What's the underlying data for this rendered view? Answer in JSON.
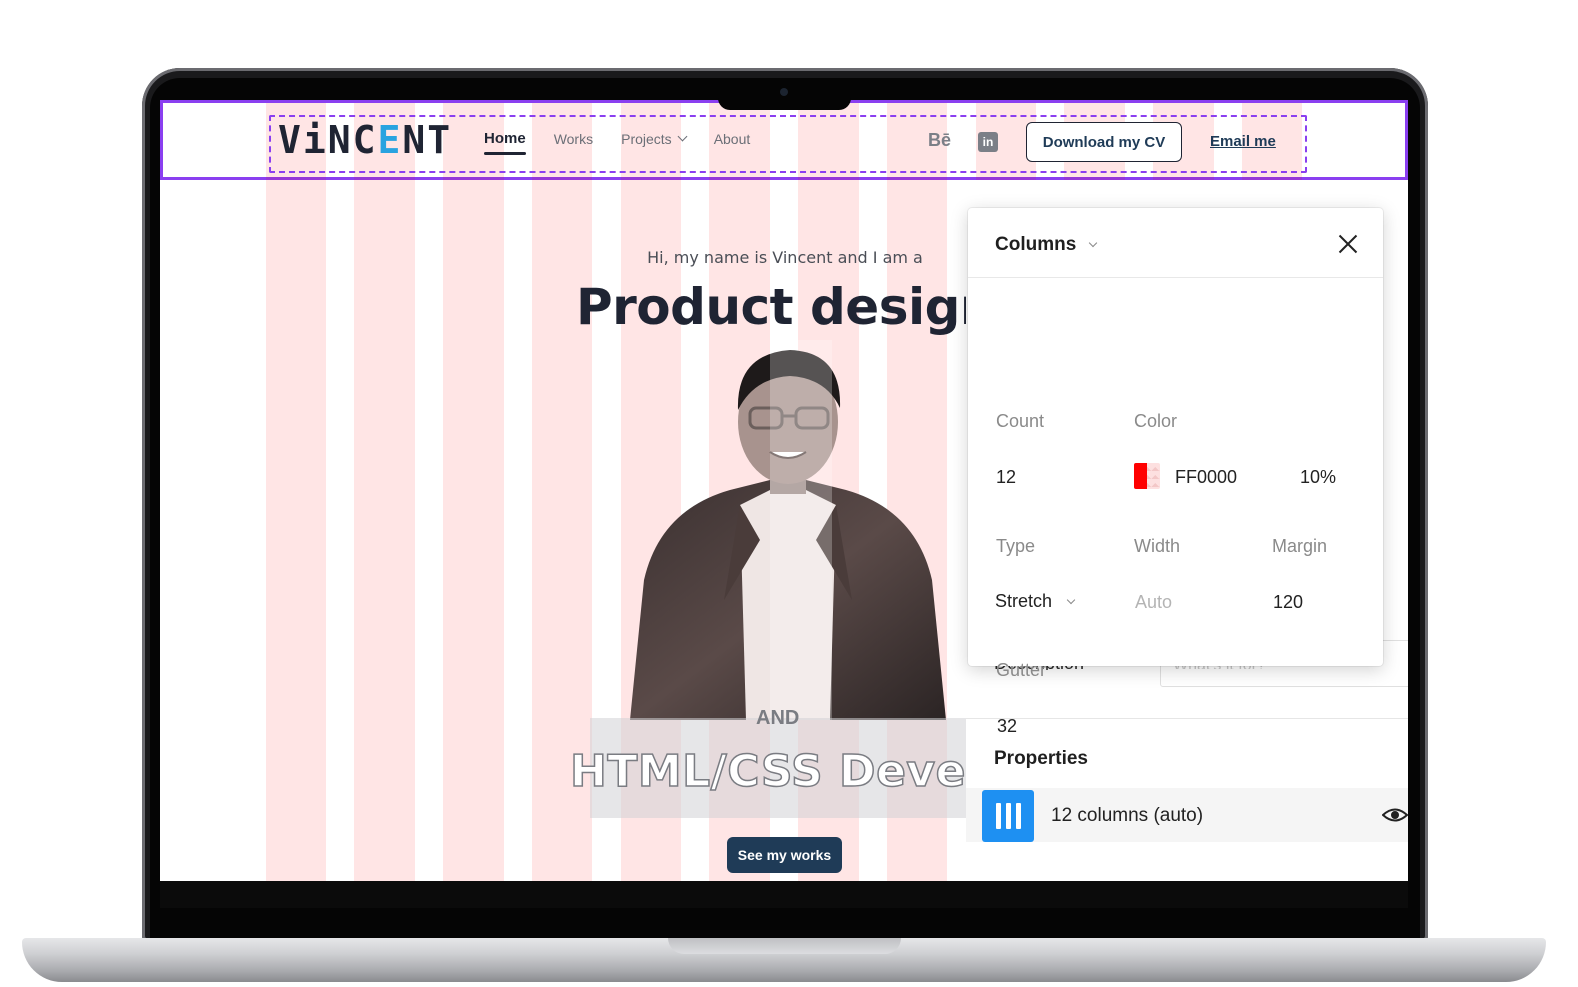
{
  "site": {
    "logo_text": "VINCENT",
    "nav": [
      {
        "label": "Home",
        "active": true
      },
      {
        "label": "Works",
        "active": false
      },
      {
        "label": "Projects",
        "active": false,
        "has_dropdown": true
      },
      {
        "label": "About",
        "active": false
      }
    ],
    "social": {
      "behance_label": "Bē",
      "linkedin_label": "in"
    },
    "cv_button": "Download my CV",
    "email_link": "Email me",
    "hero": {
      "intro": "Hi, my name is Vincent and I am a",
      "title": "Product designe",
      "and_text": "AND",
      "subtitle": "HTML/CSS Develope",
      "cta": "See my works"
    }
  },
  "design_panel": {
    "columns_popup": {
      "title": "Columns",
      "count_label": "Count",
      "count_value": "12",
      "color_label": "Color",
      "color_hex": "FF0000",
      "color_opacity": "10%",
      "type_label": "Type",
      "type_value": "Stretch",
      "width_label": "Width",
      "width_value": "Auto",
      "margin_label": "Margin",
      "margin_value": "120",
      "gutter_label": "Gutter",
      "gutter_value": "32"
    },
    "description_label": "Description",
    "description_placeholder": "What's it for?",
    "properties_heading": "Properties",
    "properties_item": "12 columns (auto)"
  },
  "colors": {
    "grid_red": "#FF0000",
    "selection_purple": "#8A3FF0",
    "brand_navy": "#1F3B57",
    "accent_blue": "#1E90F2"
  }
}
